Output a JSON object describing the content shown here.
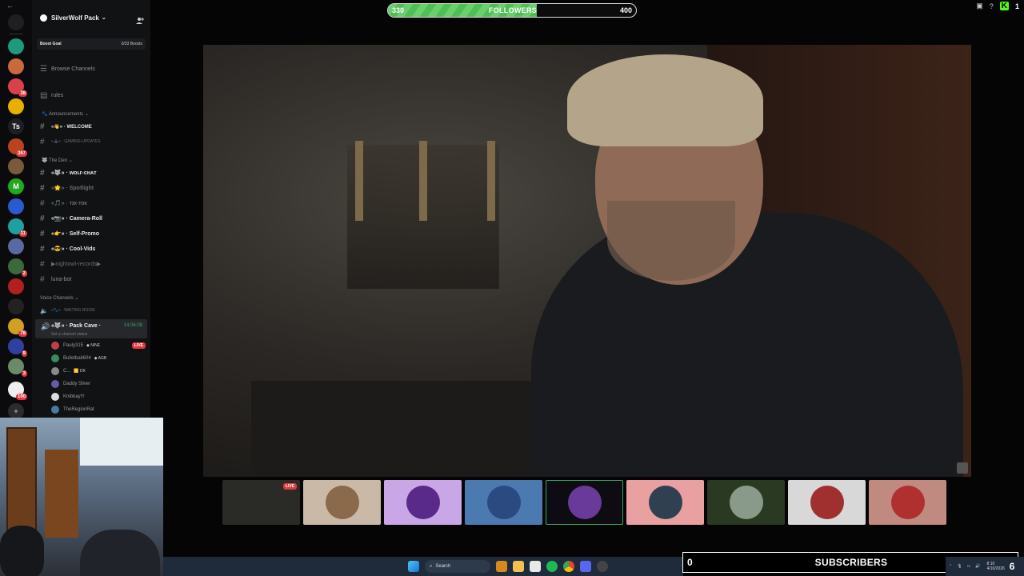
{
  "window": {
    "back_glyph": "←"
  },
  "rail": {
    "servers": [
      {
        "name": "discord-home",
        "color": "#1e1f22",
        "letter": "",
        "badge": ""
      },
      {
        "name": "server-1",
        "color": "#1e9a7a",
        "letter": "",
        "badge": ""
      },
      {
        "name": "server-2",
        "color": "#c86a3c",
        "letter": "",
        "badge": ""
      },
      {
        "name": "server-3",
        "color": "#d8414a",
        "letter": "",
        "badge": "38"
      },
      {
        "name": "server-4",
        "color": "#e8b000",
        "letter": "",
        "badge": ""
      },
      {
        "name": "server-ts",
        "color": "#1e1f22",
        "letter": "Ts",
        "badge": ""
      },
      {
        "name": "server-6",
        "color": "#b8431e",
        "letter": "",
        "badge": "367"
      },
      {
        "name": "server-7",
        "color": "#7a5a3a",
        "letter": "",
        "badge": ""
      },
      {
        "name": "server-m",
        "color": "#20a820",
        "letter": "M",
        "badge": ""
      },
      {
        "name": "server-9",
        "color": "#2a5ad0",
        "letter": "",
        "badge": ""
      },
      {
        "name": "server-10",
        "color": "#1ea0a0",
        "letter": "",
        "badge": "11"
      },
      {
        "name": "server-11",
        "color": "#5a6aa0",
        "letter": "",
        "badge": ""
      },
      {
        "name": "server-12",
        "color": "#3a6a3a",
        "letter": "",
        "badge": "2"
      },
      {
        "name": "server-13",
        "color": "#b02020",
        "letter": "",
        "badge": ""
      },
      {
        "name": "server-14",
        "color": "#222222",
        "letter": "",
        "badge": ""
      },
      {
        "name": "server-15",
        "color": "#d0a020",
        "letter": "",
        "badge": "78"
      },
      {
        "name": "server-16",
        "color": "#3040a0",
        "letter": "",
        "badge": "9"
      },
      {
        "name": "server-17",
        "color": "#6a8a6a",
        "letter": "",
        "badge": "3"
      },
      {
        "name": "server-18",
        "color": "#eeeeee",
        "letter": "",
        "badge": "100"
      }
    ]
  },
  "sidebar": {
    "server_name": "SilverWolf Pack",
    "boost_goal_label": "Boost Goal",
    "boost_goal_value": "0/33 Boosts",
    "browse_channels": "Browse Channels",
    "rules": "rules",
    "categories": {
      "announcements": "Announcements",
      "the_den": "The Den",
      "voice": "Voice Channels"
    },
    "channels": {
      "welcome": "«👋» · WELCOME",
      "gaming_updates": "«🕹» · GAMING-UPDATES",
      "wolf_chat": "«🐺» · ᴡᴏʟғ-ᴄʜᴀᴛ",
      "spotlight": "«🌟» · Spotlight",
      "tik_tok": "«🎵» · ᴛɪᴋ-ᴛᴏᴋ",
      "camera_roll": "«📷» · Camera-Roll",
      "self_promo": "«👉» · Self-Promo",
      "cool_vids": "«😎» · Cool-Vids",
      "nightowl": "▶nightowl-records▶",
      "luna_bot": "luna-bot",
      "waiting_room": "«🐾» · WAITING ROOM"
    },
    "voice_active": {
      "name": "«🐺» · Pack Cave ·",
      "status": "Set a channel status",
      "time": "14:06:08"
    },
    "voice_users": [
      {
        "name": "Pauly315",
        "tag": "◆ NINE",
        "color": "#c0404a",
        "live": "LIVE"
      },
      {
        "name": "Bulletbait604",
        "tag": "◆ AGB",
        "color": "#3a8a5a",
        "live": ""
      },
      {
        "name": "C...",
        "tag": "🟨 DK",
        "color": "#8a8a8a",
        "live": ""
      },
      {
        "name": "Daddy Silver",
        "tag": "",
        "color": "#6a5aa0",
        "live": ""
      },
      {
        "name": "Knibbay!!!",
        "tag": "",
        "color": "#dddddd",
        "live": ""
      },
      {
        "name": "TheRegionRat",
        "tag": "",
        "color": "#4a7aa0",
        "live": ""
      }
    ]
  },
  "followers": {
    "current": 330,
    "goal_start": 330,
    "goal_end": 400,
    "label": "FOLLOWERS",
    "progress": 0.6
  },
  "topright": {
    "kick_glyph": "K",
    "count": "1"
  },
  "subscribers": {
    "count": "0",
    "label": "SUBSCRIBERS",
    "right_num": "6"
  },
  "taskbar": {
    "search_placeholder": "Search",
    "clock_time": "8:10",
    "clock_date": "4/10/2026"
  },
  "thumbnails": [
    {
      "name": "thumb-stream-live",
      "bg": "#2a2a26",
      "circle": "",
      "live": "LIVE"
    },
    {
      "name": "thumb-dog",
      "bg": "#c9b9a6",
      "circle": "#8a6a4a",
      "live": ""
    },
    {
      "name": "thumb-wolf-moon",
      "bg": "#c9a6e6",
      "circle": "#5a2a8a",
      "live": ""
    },
    {
      "name": "thumb-skull",
      "bg": "#4a7ab0",
      "circle": "#2a4a80",
      "live": ""
    },
    {
      "name": "thumb-purple-wings",
      "bg": "#0c0c12",
      "circle": "#6a3a9a",
      "live": ""
    },
    {
      "name": "thumb-avatar-pink",
      "bg": "#e8a0a0",
      "circle": "#304050",
      "live": ""
    },
    {
      "name": "thumb-wolf-green",
      "bg": "#2a3a22",
      "circle": "#8a9a8a",
      "live": ""
    },
    {
      "name": "thumb-dk-logo",
      "bg": "#d8d8d8",
      "circle": "#a03030",
      "live": ""
    },
    {
      "name": "thumb-anime",
      "bg": "#c08a80",
      "circle": "#b03030",
      "live": ""
    }
  ]
}
